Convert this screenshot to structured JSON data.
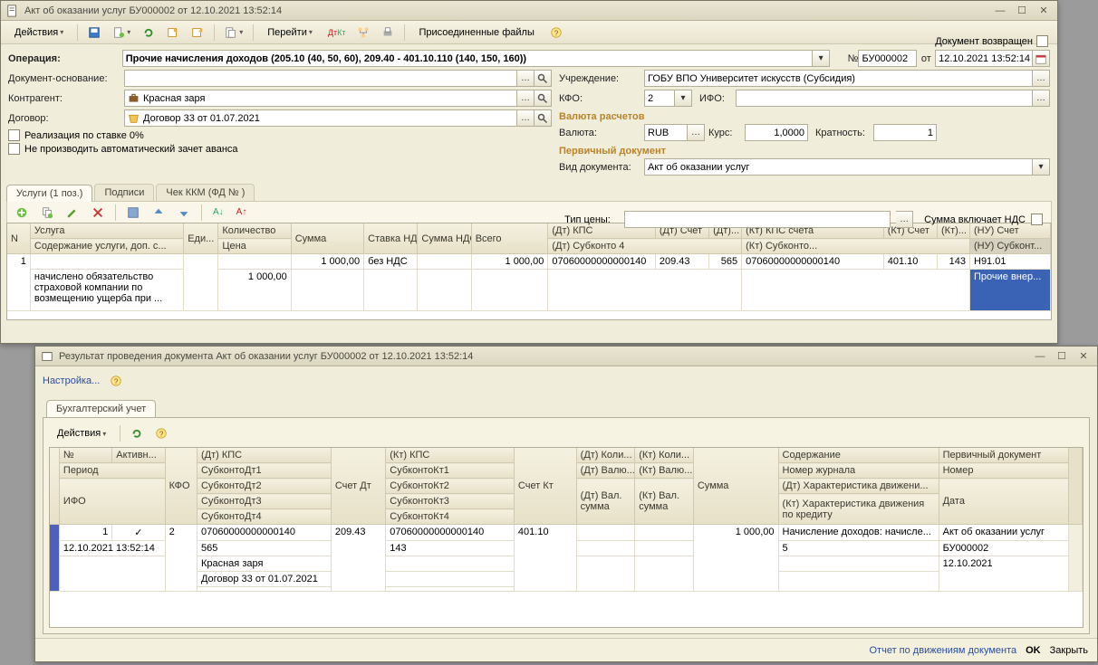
{
  "mainWindow": {
    "title": "Акт об оказании услуг БУ000002 от 12.10.2021 13:52:14",
    "toolbar": {
      "actions": "Действия",
      "goto": "Перейти",
      "dk": "Дт Кт",
      "attachments": "Присоединенные файлы"
    },
    "returned_label": "Документ возвращен",
    "form": {
      "operation_lbl": "Операция:",
      "operation_val": "Прочие начисления доходов (205.10 (40, 50, 60), 209.40 - 401.10.110 (140, 150, 160))",
      "num_lbl": "№",
      "num_val": "БУ000002",
      "date_lbl": "от",
      "date_val": "12.10.2021 13:52:14",
      "basis_lbl": "Документ-основание:",
      "basis_val": "",
      "org_lbl": "Учреждение:",
      "org_val": "ГОБУ ВПО Университет искусств (Субсидия)",
      "contragent_lbl": "Контрагент:",
      "contragent_val": "Красная заря",
      "kfo_lbl": "КФО:",
      "kfo_val": "2",
      "ifo_lbl": "ИФО:",
      "ifo_val": "",
      "contract_lbl": "Договор:",
      "contract_val": "Договор 33 от 01.07.2021",
      "currency_section": "Валюта расчетов",
      "currency_lbl": "Валюта:",
      "currency_val": "RUB",
      "rate_lbl": "Курс:",
      "rate_val": "1,0000",
      "multiplicity_lbl": "Кратность:",
      "multiplicity_val": "1",
      "primary_section": "Первичный документ",
      "doc_kind_lbl": "Вид документа:",
      "doc_kind_val": "Акт об оказании услуг",
      "price_type_lbl": "Тип цены:",
      "price_type_val": "",
      "sum_incl_vat": "Сумма включает НДС",
      "chk_zero_rate": "Реализация по ставке 0%",
      "chk_no_advance": "Не производить автоматический зачет аванса"
    },
    "tabs": {
      "services": "Услуги (1 поз.)",
      "signatures": "Подписи",
      "kkm": "Чек ККМ (ФД № )"
    },
    "grid": {
      "head": {
        "n": "N",
        "service": "Услуга",
        "unit": "Еди...",
        "qty": "Количество",
        "sum": "Сумма",
        "vat_rate": "Ставка НДС",
        "vat_sum": "Сумма НДС",
        "total": "Всего",
        "dt_kps": "(Дт) КПС",
        "dt_acct": "(Дт) Счет",
        "dt_x": "(Дт)...",
        "kt_kps": "(Кт) КПС счета",
        "kt_acct": "(Кт) Счет",
        "kt_x": "(Кт)...",
        "nu_acct": "(НУ) Счет"
      },
      "sub": {
        "desc": "Содержание услуги, доп. с...",
        "price": "Цена",
        "dt_sub4": "(Дт) Субконто 4",
        "kt_sub": "(Кт) Субконто...",
        "nu_sub": "(НУ) Субконт..."
      },
      "row": {
        "n": "1",
        "sum": "1 000,00",
        "vat_rate": "без НДС",
        "total": "1 000,00",
        "dt_kps": "07060000000000140",
        "dt_acct": "209.43",
        "dt_x": "565",
        "kt_kps": "07060000000000140",
        "kt_acct": "401.10",
        "kt_x": "143",
        "nu_acct": "Н91.01",
        "desc": "начислено обязательство страховой компании по возмещению ущерба при ...",
        "price": "1 000,00",
        "nu_sub": "Прочие внер..."
      }
    }
  },
  "childWindow": {
    "title": "Результат проведения документа Акт об оказании услуг БУ000002 от 12.10.2021 13:52:14",
    "settings": "Настройка...",
    "tab": "Бухгалтерский учет",
    "toolbar_actions": "Действия",
    "grid": {
      "head": {
        "num": "№",
        "active": "Активн...",
        "kfo": "КФО",
        "dt_kps": "(Дт) КПС",
        "acct_dt": "Счет Дт",
        "kt_kps": "(Кт) КПС",
        "acct_kt": "Счет Кт",
        "dt_qty": "(Дт) Коли...",
        "kt_qty": "(Кт) Коли...",
        "sum": "Сумма",
        "content": "Содержание",
        "primary": "Первичный документ"
      },
      "sub": {
        "period": "Период",
        "ifo": "ИФО",
        "sdt1": "СубконтоДт1",
        "sdt2": "СубконтоДт2",
        "sdt3": "СубконтоДт3",
        "sdt4": "СубконтоДт4",
        "skt1": "СубконтоКт1",
        "skt2": "СубконтоКт2",
        "skt3": "СубконтоКт3",
        "skt4": "СубконтоКт4",
        "dt_cur": "(Дт) Валю...",
        "kt_cur": "(Кт) Валю...",
        "dt_cur_sum": "(Дт) Вал. сумма",
        "kt_cur_sum": "(Кт) Вал. сумма",
        "journal": "Номер журнала",
        "dt_char": "(Дт) Характеристика движени...",
        "kt_char": "(Кт) Характеристика движения по кредиту",
        "number": "Номер",
        "date": "Дата"
      },
      "row": {
        "num": "1",
        "active_mark": "✓",
        "kfo": "2",
        "dt_kps": "07060000000000140",
        "acct_dt": "209.43",
        "kt_kps": "07060000000000140",
        "acct_kt": "401.10",
        "sum": "1 000,00",
        "content": "Начисление доходов: начисле...",
        "primary": "Акт об оказании услуг",
        "period": "12.10.2021 13:52:14",
        "sdt1": "565",
        "skt1": "143",
        "sdt2": "Красная заря",
        "sdt3": "Договор 33 от 01.07.2021",
        "journal": "5",
        "number": "БУ000002",
        "date": "12.10.2021"
      }
    },
    "footer": {
      "report": "Отчет по движениям документа",
      "ok": "OK",
      "close": "Закрыть"
    }
  }
}
